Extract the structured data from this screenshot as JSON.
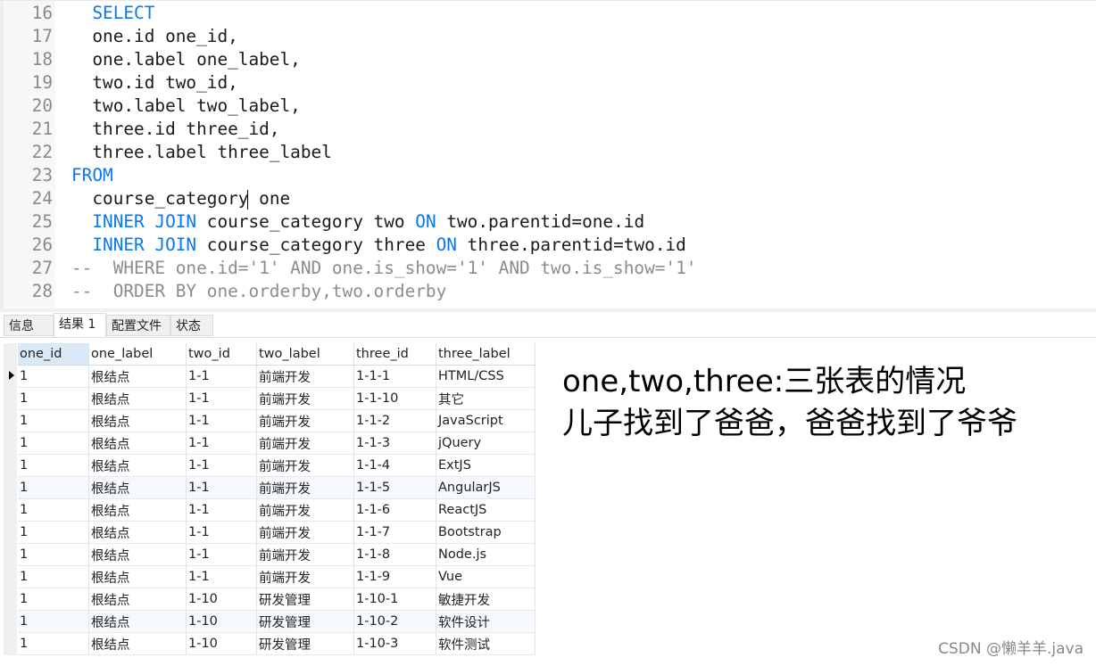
{
  "editor": {
    "lines": [
      {
        "num": "16",
        "segs": [
          {
            "t": "  "
          },
          {
            "t": "SELECT",
            "c": "kw"
          }
        ]
      },
      {
        "num": "17",
        "segs": [
          {
            "t": "  one.id one_id,"
          }
        ]
      },
      {
        "num": "18",
        "segs": [
          {
            "t": "  one.label one_label,"
          }
        ]
      },
      {
        "num": "19",
        "segs": [
          {
            "t": "  two.id two_id,"
          }
        ]
      },
      {
        "num": "20",
        "segs": [
          {
            "t": "  two.label two_label,"
          }
        ]
      },
      {
        "num": "21",
        "segs": [
          {
            "t": "  three.id three_id,"
          }
        ]
      },
      {
        "num": "22",
        "segs": [
          {
            "t": "  three.label three_label"
          }
        ]
      },
      {
        "num": "23",
        "segs": [
          {
            "t": "FROM",
            "c": "kw"
          }
        ]
      },
      {
        "num": "24",
        "segs": [
          {
            "t": "  course_category"
          },
          {
            "cursor": true
          },
          {
            "t": " one"
          }
        ]
      },
      {
        "num": "25",
        "segs": [
          {
            "t": "  "
          },
          {
            "t": "INNER JOIN",
            "c": "kw"
          },
          {
            "t": " course_category two "
          },
          {
            "t": "ON",
            "c": "kw"
          },
          {
            "t": " two.parentid=one.id"
          }
        ]
      },
      {
        "num": "26",
        "segs": [
          {
            "t": "  "
          },
          {
            "t": "INNER JOIN",
            "c": "kw"
          },
          {
            "t": " course_category three "
          },
          {
            "t": "ON",
            "c": "kw"
          },
          {
            "t": " three.parentid=two.id"
          }
        ]
      },
      {
        "num": "27",
        "segs": [
          {
            "t": "--  WHERE one.id='1' AND one.is_show='1' AND two.is_show='1'",
            "c": "cm"
          }
        ]
      },
      {
        "num": "28",
        "segs": [
          {
            "t": "--  ORDER BY one.orderby,two.orderby",
            "c": "cm"
          }
        ]
      }
    ],
    "colors": {
      "keyword": "#0a78f0",
      "comment": "#8c8c8c"
    }
  },
  "tabs": [
    {
      "label": "信息",
      "active": false
    },
    {
      "label": "结果 1",
      "active": true
    },
    {
      "label": "配置文件",
      "active": false
    },
    {
      "label": "状态",
      "active": false
    }
  ],
  "result": {
    "columns": [
      "one_id",
      "one_label",
      "two_id",
      "two_label",
      "three_id",
      "three_label"
    ],
    "rows": [
      [
        "1",
        "根结点",
        "1-1",
        "前端开发",
        "1-1-1",
        "HTML/CSS"
      ],
      [
        "1",
        "根结点",
        "1-1",
        "前端开发",
        "1-1-10",
        "其它"
      ],
      [
        "1",
        "根结点",
        "1-1",
        "前端开发",
        "1-1-2",
        "JavaScript"
      ],
      [
        "1",
        "根结点",
        "1-1",
        "前端开发",
        "1-1-3",
        "jQuery"
      ],
      [
        "1",
        "根结点",
        "1-1",
        "前端开发",
        "1-1-4",
        "ExtJS"
      ],
      [
        "1",
        "根结点",
        "1-1",
        "前端开发",
        "1-1-5",
        "AngularJS"
      ],
      [
        "1",
        "根结点",
        "1-1",
        "前端开发",
        "1-1-6",
        "ReactJS"
      ],
      [
        "1",
        "根结点",
        "1-1",
        "前端开发",
        "1-1-7",
        "Bootstrap"
      ],
      [
        "1",
        "根结点",
        "1-1",
        "前端开发",
        "1-1-8",
        "Node.js"
      ],
      [
        "1",
        "根结点",
        "1-1",
        "前端开发",
        "1-1-9",
        "Vue"
      ],
      [
        "1",
        "根结点",
        "1-10",
        "研发管理",
        "1-10-1",
        "敏捷开发"
      ],
      [
        "1",
        "根结点",
        "1-10",
        "研发管理",
        "1-10-2",
        "软件设计"
      ],
      [
        "1",
        "根结点",
        "1-10",
        "研发管理",
        "1-10-3",
        "软件测试"
      ]
    ]
  },
  "annotation": {
    "line1": "one,two,three:三张表的情况",
    "line2": "儿子找到了爸爸，爸爸找到了爷爷"
  },
  "watermark": "CSDN @懒羊羊.java"
}
